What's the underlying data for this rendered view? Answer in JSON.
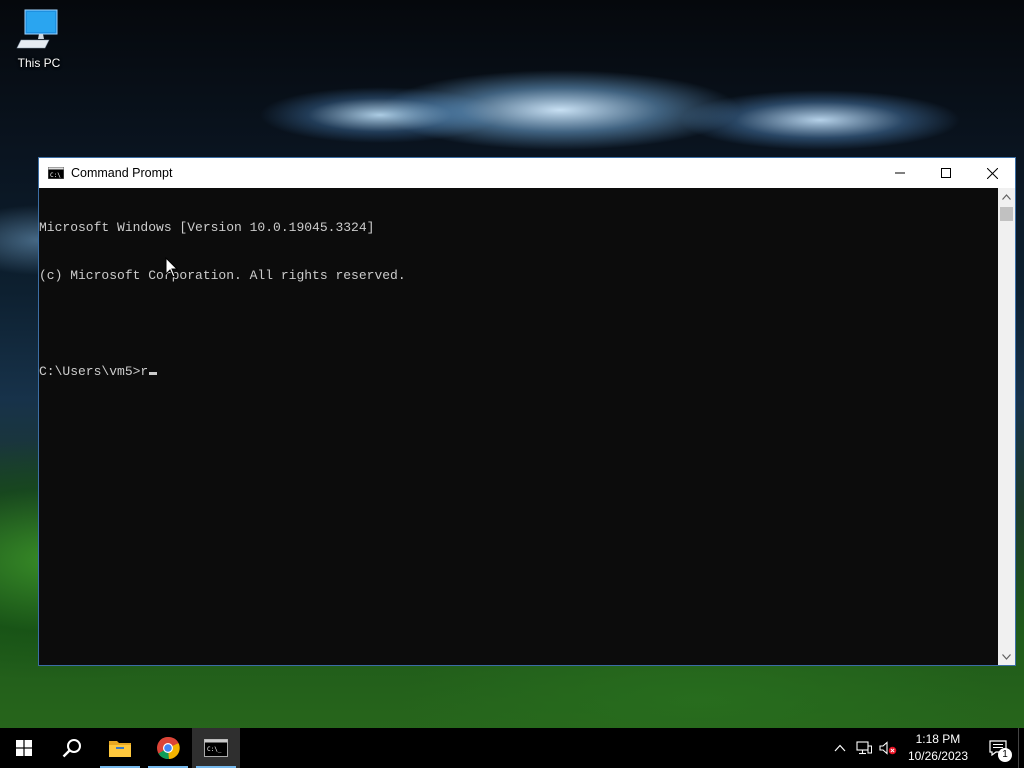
{
  "desktop": {
    "icons": [
      {
        "label": "This PC",
        "icon": "computer-icon"
      }
    ]
  },
  "window": {
    "title": "Command Prompt",
    "icon": "cmd-icon",
    "controls": {
      "minimize": "minimize-icon",
      "maximize": "maximize-icon",
      "close": "close-icon"
    },
    "console": {
      "lines": [
        "Microsoft Windows [Version 10.0.19045.3324]",
        "(c) Microsoft Corporation. All rights reserved.",
        "",
        "C:\\Users\\vm5>r"
      ]
    }
  },
  "taskbar": {
    "items": [
      {
        "name": "start",
        "icon": "windows-logo-icon"
      },
      {
        "name": "search",
        "icon": "search-icon"
      },
      {
        "name": "file-explorer",
        "icon": "folder-icon"
      },
      {
        "name": "chrome",
        "icon": "chrome-icon"
      },
      {
        "name": "command-prompt",
        "icon": "cmd-icon",
        "active": true
      }
    ],
    "tray": {
      "icons": [
        "chevron-up-icon",
        "network-icon",
        "volume-muted-icon"
      ],
      "time": "1:18 PM",
      "date": "10/26/2023",
      "notifications_count": "1"
    }
  },
  "colors": {
    "console_bg": "#0c0c0c",
    "console_text": "#cccccc",
    "taskbar_bg": "#000000",
    "accent": "#76b9ed"
  }
}
